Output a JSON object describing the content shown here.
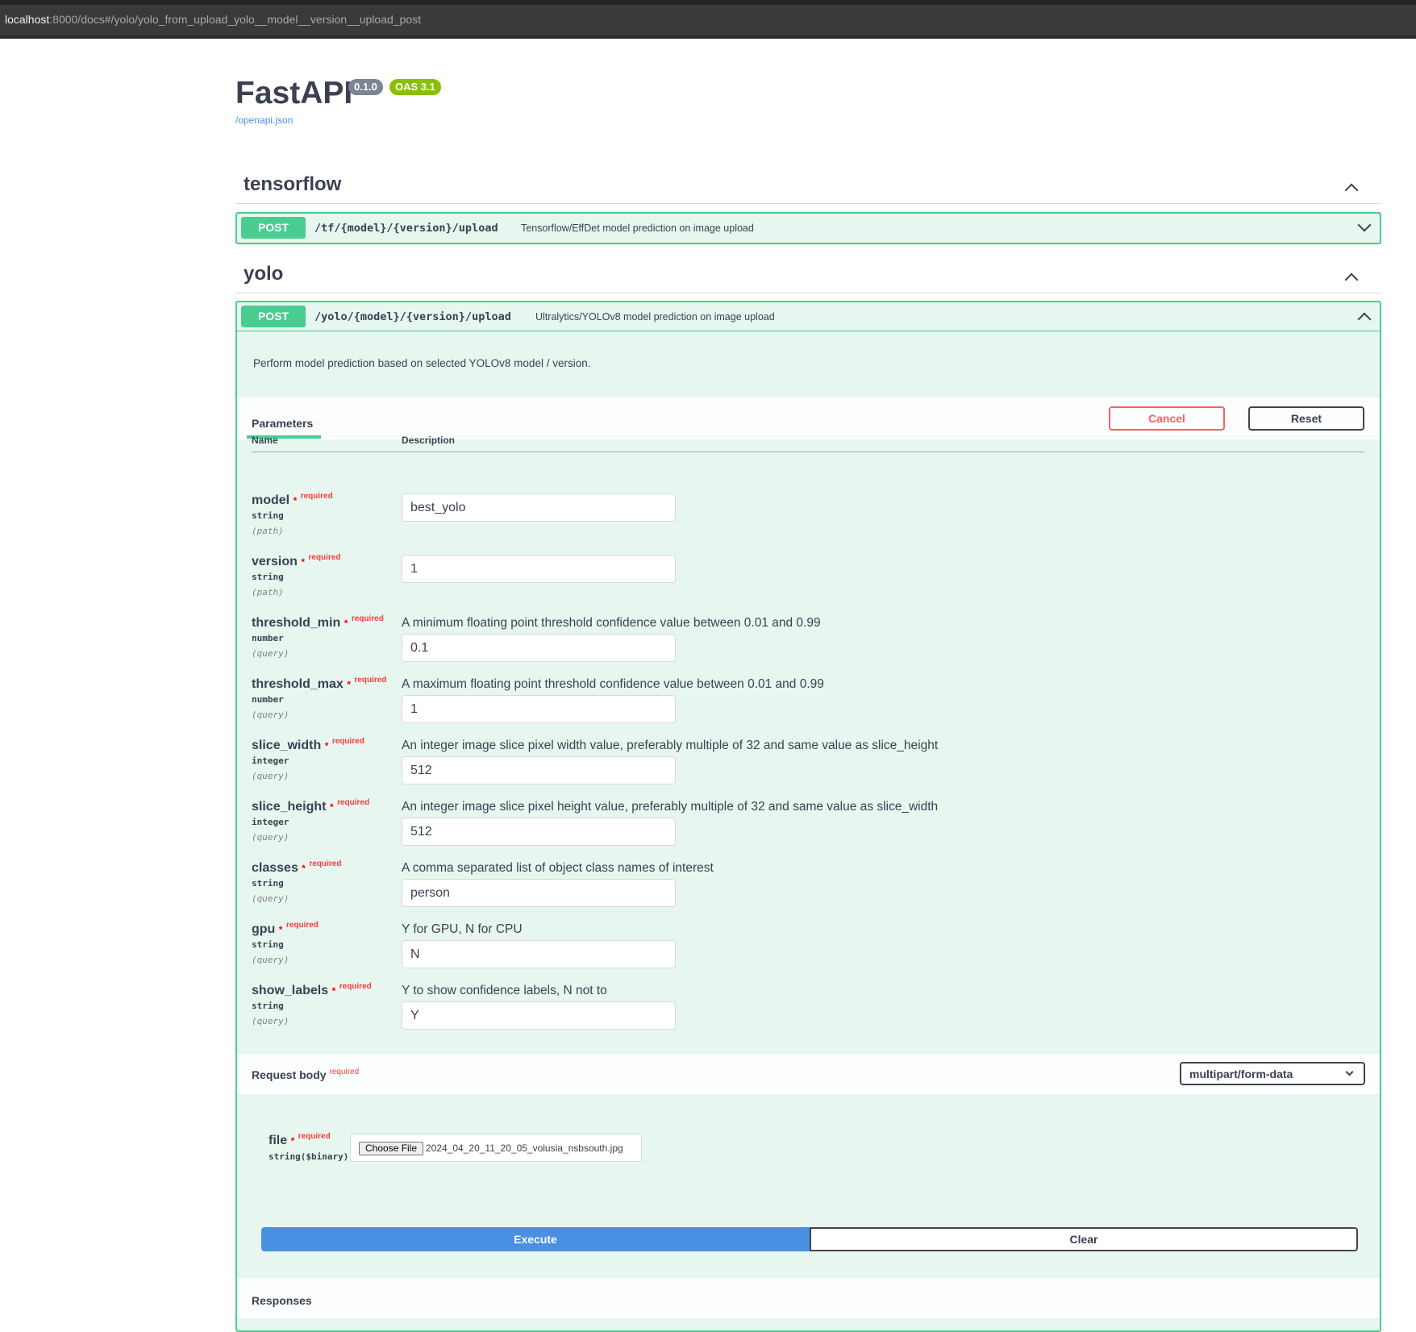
{
  "browser": {
    "url_host": "localhost",
    "url_rest": ":8000/docs#/yolo/yolo_from_upload_yolo__model__version__upload_post"
  },
  "header": {
    "title": "FastAPI",
    "version_badge": "0.1.0",
    "oas_badge": "OAS 3.1",
    "spec_link": "/openapi.json"
  },
  "tags": [
    {
      "name": "tensorflow",
      "operation": {
        "method": "POST",
        "path": "/tf/{model}/{version}/upload",
        "summary": "Tensorflow/EffDet model prediction on image upload"
      }
    },
    {
      "name": "yolo",
      "operation": {
        "method": "POST",
        "path": "/yolo/{model}/{version}/upload",
        "summary": "Ultralytics/YOLOv8 model prediction on image upload",
        "description": "Perform model prediction based on selected YOLOv8 model / version."
      }
    }
  ],
  "parameters_section": {
    "tab_label": "Parameters",
    "cancel_label": "Cancel",
    "reset_label": "Reset",
    "col_name": "Name",
    "col_description": "Description",
    "required_star": "*",
    "required_label": "required"
  },
  "params": [
    {
      "name": "model",
      "type": "string",
      "in": "(path)",
      "description": "",
      "value": "best_yolo"
    },
    {
      "name": "version",
      "type": "string",
      "in": "(path)",
      "description": "",
      "value": "1"
    },
    {
      "name": "threshold_min",
      "type": "number",
      "in": "(query)",
      "description": "A minimum floating point threshold confidence value between 0.01 and 0.99",
      "value": "0.1"
    },
    {
      "name": "threshold_max",
      "type": "number",
      "in": "(query)",
      "description": "A maximum floating point threshold confidence value between 0.01 and 0.99",
      "value": "1"
    },
    {
      "name": "slice_width",
      "type": "integer",
      "in": "(query)",
      "description": "An integer image slice pixel width value, preferably multiple of 32 and same value as slice_height",
      "value": "512"
    },
    {
      "name": "slice_height",
      "type": "integer",
      "in": "(query)",
      "description": "An integer image slice pixel height value, preferably multiple of 32 and same value as slice_width",
      "value": "512"
    },
    {
      "name": "classes",
      "type": "string",
      "in": "(query)",
      "description": "A comma separated list of object class names of interest",
      "value": "person"
    },
    {
      "name": "gpu",
      "type": "string",
      "in": "(query)",
      "description": "Y for GPU, N for CPU",
      "value": "N"
    },
    {
      "name": "show_labels",
      "type": "string",
      "in": "(query)",
      "description": "Y to show confidence labels, N not to",
      "value": "Y"
    }
  ],
  "request_body": {
    "title": "Request body",
    "required_label": "required",
    "content_type": "multipart/form-data",
    "file_field": {
      "name": "file",
      "type": "string($binary)",
      "choose_label": "Choose File",
      "chosen_file": "2024_04_20_11_20_05_volusia_nsbsouth.jpg"
    }
  },
  "actions": {
    "execute_label": "Execute",
    "clear_label": "Clear"
  },
  "responses": {
    "title": "Responses"
  },
  "colors": {
    "post_green": "#49cc90",
    "post_bg": "#e8f6f0",
    "execute_blue": "#4990e2",
    "cancel_red": "#ff6060",
    "oas_green": "#89bf04",
    "version_gray": "#7d8492"
  }
}
